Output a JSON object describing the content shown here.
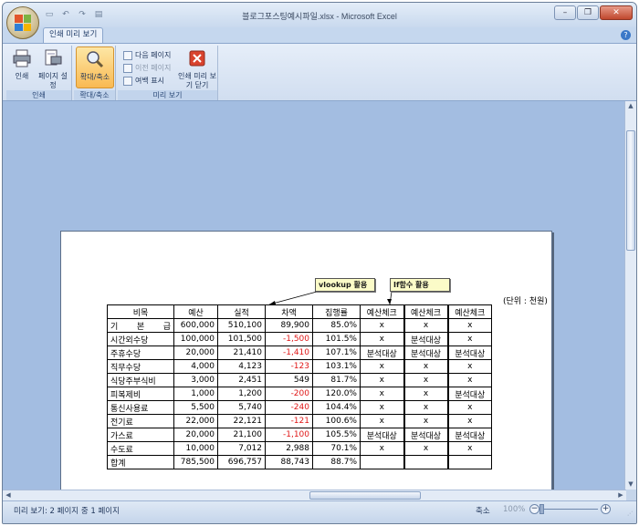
{
  "window": {
    "title": "블로그포스팅예시파일.xlsx - Microsoft Excel"
  },
  "ribbon": {
    "tab_active": "인쇄 미리 보기",
    "groups": {
      "print": {
        "label": "인쇄",
        "print_btn": "인쇄",
        "page_setup_btn": "페이지 설정"
      },
      "zoom": {
        "label": "확대/축소",
        "zoom_btn": "확대/축소"
      },
      "preview": {
        "label": "미리 보기",
        "next_page": "다음 페이지",
        "prev_page": "이전 페이지",
        "show_margins": "여백 표시",
        "close_btn": "인쇄 미리 보기 닫기"
      }
    }
  },
  "sheet": {
    "unit": "(단위 : 천원)",
    "callouts": {
      "vlookup": "vlookup 활용",
      "if": "If함수 활용"
    },
    "headers": [
      "비목",
      "예산",
      "실적",
      "차액",
      "집행률",
      "예산체크",
      "예산체크",
      "예산체크"
    ],
    "rows": [
      {
        "item": "기 본 급",
        "budget": "600,000",
        "actual": "510,100",
        "diff": "89,900",
        "rate": "85.0%",
        "c1": "x",
        "c2": "x",
        "c3": "x"
      },
      {
        "item": "시간외수당",
        "budget": "100,000",
        "actual": "101,500",
        "diff": "-1,500",
        "rate": "101.5%",
        "c1": "x",
        "c2": "분석대상",
        "c3": "x"
      },
      {
        "item": "주휴수당",
        "budget": "20,000",
        "actual": "21,410",
        "diff": "-1,410",
        "rate": "107.1%",
        "c1": "분석대상",
        "c2": "분석대상",
        "c3": "분석대상"
      },
      {
        "item": "직무수당",
        "budget": "4,000",
        "actual": "4,123",
        "diff": "-123",
        "rate": "103.1%",
        "c1": "x",
        "c2": "x",
        "c3": "x"
      },
      {
        "item": "식당주부식비",
        "budget": "3,000",
        "actual": "2,451",
        "diff": "549",
        "rate": "81.7%",
        "c1": "x",
        "c2": "x",
        "c3": "x"
      },
      {
        "item": "피복제비",
        "budget": "1,000",
        "actual": "1,200",
        "diff": "-200",
        "rate": "120.0%",
        "c1": "x",
        "c2": "x",
        "c3": "분석대상"
      },
      {
        "item": "통신사용료",
        "budget": "5,500",
        "actual": "5,740",
        "diff": "-240",
        "rate": "104.4%",
        "c1": "x",
        "c2": "x",
        "c3": "x"
      },
      {
        "item": "전기료",
        "budget": "22,000",
        "actual": "22,121",
        "diff": "-121",
        "rate": "100.6%",
        "c1": "x",
        "c2": "x",
        "c3": "x"
      },
      {
        "item": "가스료",
        "budget": "20,000",
        "actual": "21,100",
        "diff": "-1,100",
        "rate": "105.5%",
        "c1": "분석대상",
        "c2": "분석대상",
        "c3": "분석대상"
      },
      {
        "item": "수도료",
        "budget": "10,000",
        "actual": "7,012",
        "diff": "2,988",
        "rate": "70.1%",
        "c1": "x",
        "c2": "x",
        "c3": "x"
      }
    ],
    "total": {
      "item": "합계",
      "budget": "785,500",
      "actual": "696,757",
      "diff": "88,743",
      "rate": "88.7%"
    }
  },
  "status": {
    "text": "미리 보기: 2 페이지 중 1 페이지",
    "zoom_label": "축소",
    "zoom_pct": "100%"
  },
  "colors": {
    "negative": "#e01818",
    "accent": "#f9b952"
  }
}
